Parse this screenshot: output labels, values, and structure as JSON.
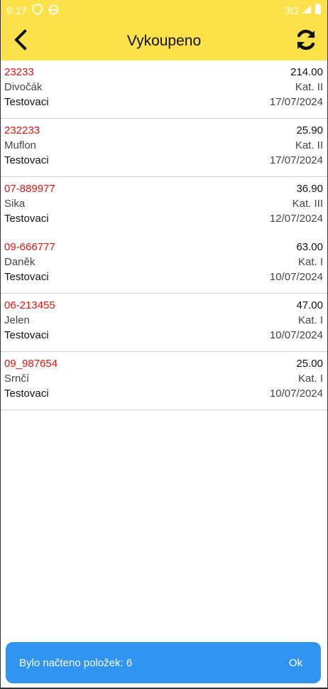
{
  "status_bar": {
    "time": "9:17",
    "network": "3G"
  },
  "app_bar": {
    "title": "Vykoupeno"
  },
  "items": [
    {
      "code": "23233",
      "amount": "214.00",
      "species": "Divočák",
      "category": "Kat. II",
      "owner": "Testovaci",
      "date": "17/07/2024"
    },
    {
      "code": "232233",
      "amount": "25.90",
      "species": "Muflon",
      "category": "Kat. II",
      "owner": "Testovaci",
      "date": "17/07/2024"
    },
    {
      "code": "07-889977",
      "amount": "36.90",
      "species": "Sika",
      "category": "Kat. III",
      "owner": "Testovaci",
      "date": "12/07/2024"
    },
    {
      "code": "09-666777",
      "amount": "63.00",
      "species": "Daněk",
      "category": "Kat. I",
      "owner": "Testovaci",
      "date": "10/07/2024"
    },
    {
      "code": "06-213455",
      "amount": "47.00",
      "species": "Jelen",
      "category": "Kat. I",
      "owner": "Testovaci",
      "date": "10/07/2024"
    },
    {
      "code": "09_987654",
      "amount": "25.00",
      "species": "Srnčí",
      "category": "Kat. I",
      "owner": "Testovaci",
      "date": "10/07/2024"
    }
  ],
  "snackbar": {
    "message": "Bylo načteno položek: 6",
    "action": "Ok"
  },
  "colors": {
    "accent": "#fce14a",
    "code_red": "#e3140f",
    "snackbar_blue": "#2f95f1"
  }
}
